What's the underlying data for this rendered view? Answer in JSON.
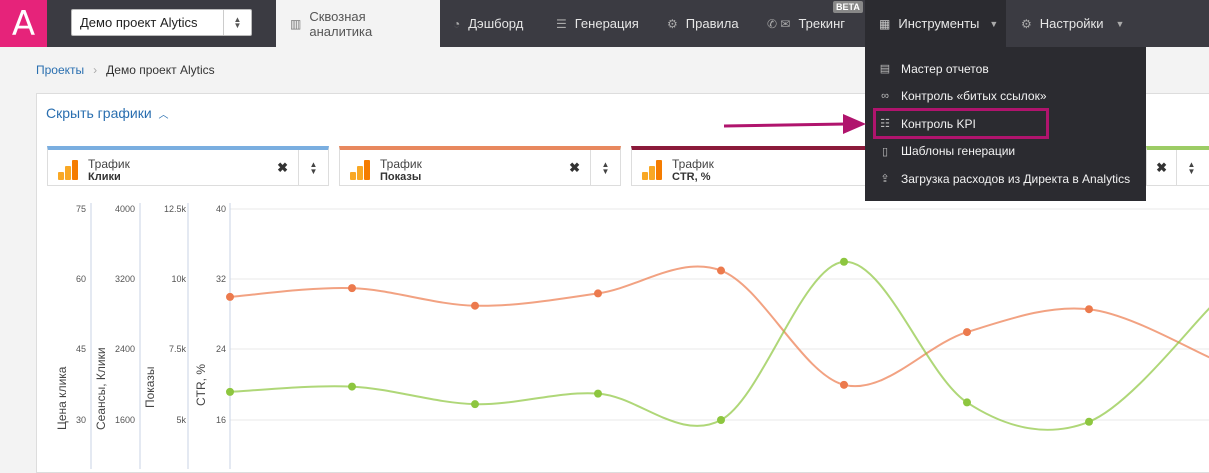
{
  "app": {
    "logo_letter": "A",
    "brand_color": "#e6237a"
  },
  "project_select": {
    "value": "Демо проект Alytics"
  },
  "nav": {
    "tabs": [
      {
        "label": "Сквозная аналитика",
        "icon": "bar-chart-icon",
        "active": true
      },
      {
        "label": "Дэшборд",
        "icon": "gauge-icon"
      },
      {
        "label": "Генерация",
        "icon": "list-icon"
      },
      {
        "label": "Правила",
        "icon": "gears-icon"
      },
      {
        "label": "Трекинг",
        "icon": "phone-mail-icon",
        "badge": "BETA"
      },
      {
        "label": "Инструменты",
        "icon": "grid-icon",
        "open": true
      },
      {
        "label": "Настройки",
        "icon": "gear-icon"
      }
    ]
  },
  "breadcrumb": {
    "items": [
      "Проекты",
      "Демо проект Alytics"
    ]
  },
  "charts_toggle": {
    "label": "Скрыть графики"
  },
  "metric_cards": [
    {
      "title": "Трафик",
      "metric": "Клики",
      "color": "#7aaee0"
    },
    {
      "title": "Трафик",
      "metric": "Показы",
      "color": "#e8885e"
    },
    {
      "title": "Трафик",
      "metric": "CTR, %",
      "color": "#8b1a3a"
    },
    {
      "title": "",
      "metric": "",
      "color": "#9ccc65"
    }
  ],
  "tools_menu": {
    "items": [
      {
        "label": "Мастер отчетов",
        "icon": "report-icon"
      },
      {
        "label": "Контроль «битых ссылок»",
        "icon": "link-icon"
      },
      {
        "label": "Контроль KPI",
        "icon": "sliders-icon",
        "highlighted": true
      },
      {
        "label": "Шаблоны генерации",
        "icon": "document-icon"
      },
      {
        "label": "Загрузка расходов из Директа в Analytics",
        "icon": "upload-icon"
      }
    ],
    "highlight_color": "#b0146d"
  },
  "chart_data": {
    "type": "line",
    "axes": [
      {
        "label": "Цена клика",
        "ticks": [
          "75",
          "60",
          "45",
          "30"
        ]
      },
      {
        "label": "Сеансы, Клики",
        "ticks": [
          "4000",
          "3200",
          "2400",
          "1600"
        ]
      },
      {
        "label": "Показы",
        "ticks": [
          "12.5k",
          "10k",
          "7.5k",
          "5k"
        ]
      },
      {
        "label": "CTR, %",
        "ticks": [
          "40",
          "32",
          "24",
          "16"
        ]
      }
    ],
    "series": [
      {
        "color": "#ec7a4d",
        "values": [
          30.0,
          31.0,
          29.0,
          30.4,
          33.0,
          20.0,
          26.0,
          28.6,
          23.0
        ]
      },
      {
        "color": "#8dc63f",
        "values": [
          19.2,
          19.8,
          17.8,
          19.0,
          16.0,
          34.0,
          18.0,
          15.8,
          29.0
        ]
      }
    ]
  }
}
